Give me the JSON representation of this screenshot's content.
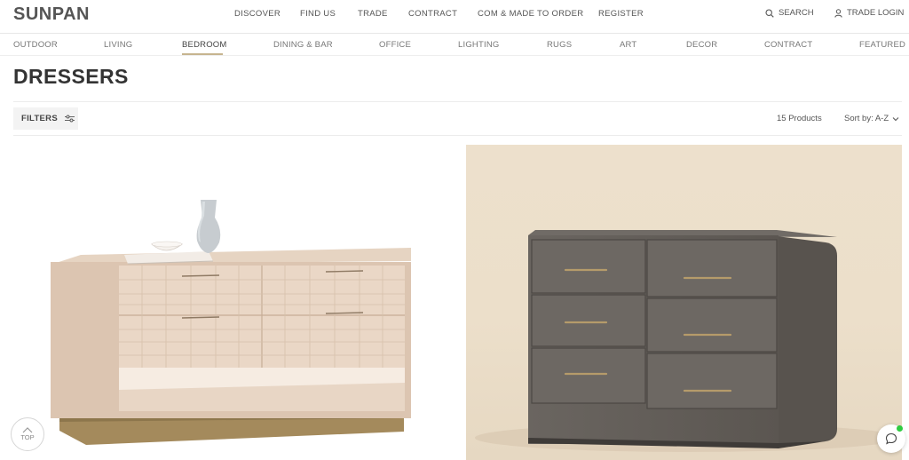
{
  "brand": {
    "logo": "SUNPAN"
  },
  "main_nav": [
    "DISCOVER",
    "FIND US",
    "TRADE",
    "CONTRACT",
    "COM & MADE TO ORDER",
    "REGISTER"
  ],
  "utility": {
    "search_label": "SEARCH",
    "search_icon": "search-icon",
    "login_label": "TRADE LOGIN",
    "login_icon": "user-icon"
  },
  "category_nav": {
    "items": [
      "OUTDOOR",
      "LIVING",
      "BEDROOM",
      "DINING & BAR",
      "OFFICE",
      "LIGHTING",
      "RUGS",
      "ART",
      "DECOR",
      "CONTRACT",
      "FEATURED"
    ],
    "active": "BEDROOM",
    "accent_color": "#c6b48f"
  },
  "page": {
    "title": "DRESSERS"
  },
  "toolbar": {
    "filters_label": "FILTERS",
    "filters_icon": "sliders-icon",
    "product_count": "15 Products",
    "sort_label": "Sort by: A-Z",
    "sort_icon": "chevron-down-icon"
  },
  "products": [
    {
      "image": "light-oak-dresser-with-vase"
    },
    {
      "image": "grey-six-drawer-dresser"
    }
  ],
  "floating": {
    "top_label": "TOP",
    "top_icon": "chevron-up-icon",
    "chat_icon": "chat-bubble-icon",
    "chat_status_color": "#2ecc40"
  }
}
